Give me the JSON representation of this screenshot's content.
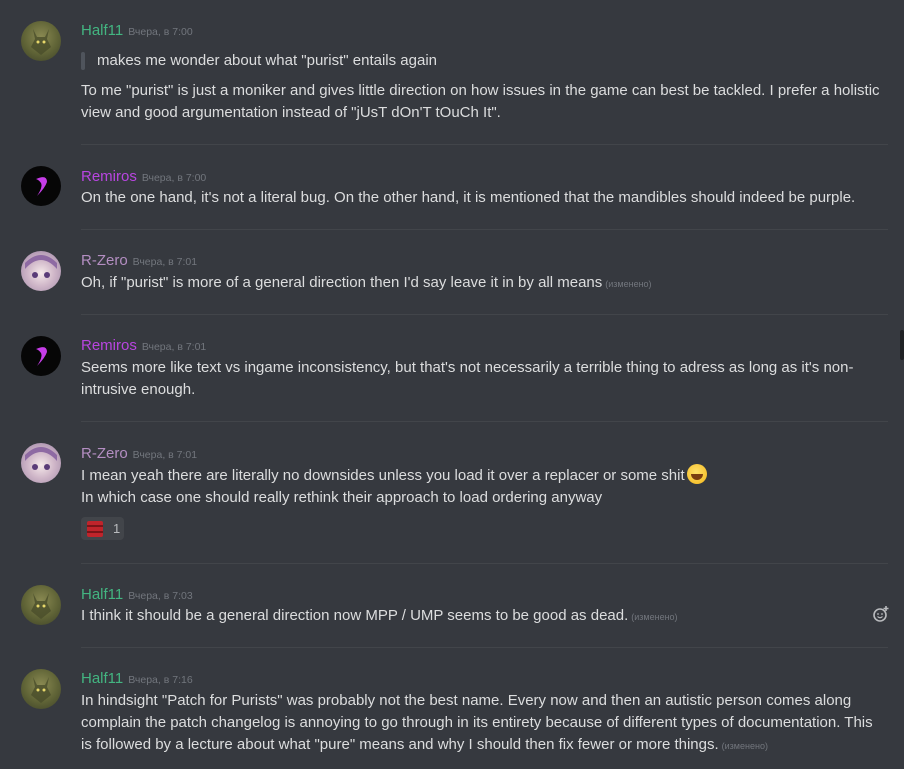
{
  "colors": {
    "half11": "#43b581",
    "remiros": "#b845e0",
    "rzero": "#b48ec2"
  },
  "messages": [
    {
      "author": "Half11",
      "timestamp": "Вчера, в 7:00",
      "quote": "makes me wonder about what \"purist\" entails again",
      "text": "To me \"purist\" is just a moniker and gives little direction on how issues in the game can best be tackled. I prefer a holistic view and good argumentation instead of \"jUsT dOn'T tOuCh It\"."
    },
    {
      "author": "Remiros",
      "timestamp": "Вчера, в 7:00",
      "text": "On the one hand, it's not a literal bug. On the other hand, it is mentioned that the mandibles should indeed be purple."
    },
    {
      "author": "R-Zero",
      "timestamp": "Вчера, в 7:01",
      "text": "Oh, if \"purist\" is more of a general direction then I'd say leave it in by all means",
      "edited": "(изменено)"
    },
    {
      "author": "Remiros",
      "timestamp": "Вчера, в 7:01",
      "text": "Seems more like text vs ingame inconsistency, but that's not necessarily a terrible thing to adress as long as it's non-intrusive enough."
    },
    {
      "author": "R-Zero",
      "timestamp": "Вчера, в 7:01",
      "line1": "I mean yeah there are literally no downsides unless you load it over a replacer or some shit",
      "line2": "In which case one should really rethink their approach to load ordering anyway",
      "emoji": "grinning-face-emoji",
      "reaction": {
        "emoji": "red-custom-emoji",
        "count": "1"
      }
    },
    {
      "author": "Half11",
      "timestamp": "Вчера, в 7:03",
      "text": "I think it should be a general direction now MPP / UMP seems to be good as dead.",
      "edited": "(изменено)"
    },
    {
      "author": "Half11",
      "timestamp": "Вчера, в 7:16",
      "text": "In hindsight \"Patch for Purists\" was probably not the best name. Every now and then an autistic person comes along complain the patch changelog is annoying to go through in its entirety because of different types of documentation. This is followed by a lecture about what \"pure\" means and why I should then fix fewer or more things.",
      "edited": "(изменено)"
    }
  ],
  "icons": {
    "add_reaction": "add-reaction-icon"
  }
}
